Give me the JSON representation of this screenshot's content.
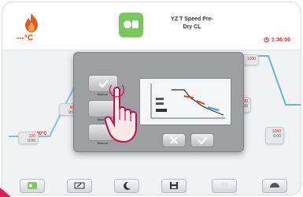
{
  "header": {
    "temperature": "---°C",
    "program_name_line1": "YZ T Speed Pre-",
    "program_name_line2": "Dry CL",
    "timer": "1:36:05"
  },
  "graph": {
    "start_temp": "100°C",
    "stages": [
      {
        "value1": "100",
        "value2": "0:00"
      },
      {
        "value1": "410",
        "value2": "0:00"
      },
      {
        "value1": "1000",
        "value2": "0:00"
      },
      {
        "value1": "1300",
        "value2": "0:00"
      },
      {
        "value1": "1040",
        "value2": "0:00"
      }
    ]
  },
  "dialog": {
    "options": [
      "Manual",
      "Manual",
      "Manual"
    ]
  },
  "colors": {
    "accent_green": "#78c85a",
    "temp_red": "#e04a1f",
    "timer_red": "#d62828",
    "curve_teal": "#6bb7c6",
    "corner_pink": "#e41b5b"
  }
}
